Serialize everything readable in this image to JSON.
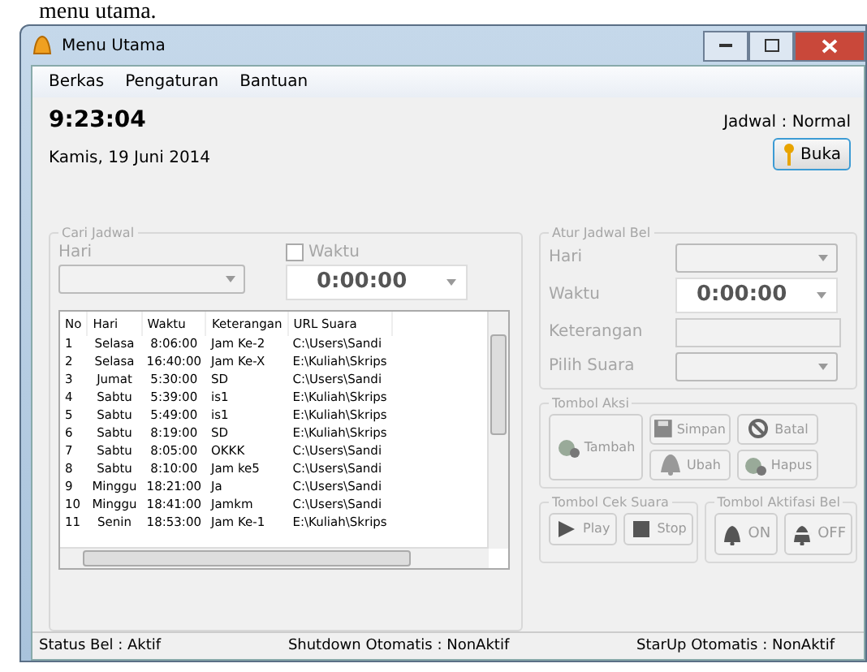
{
  "caption": "menu utama.",
  "window": {
    "title": "Menu Utama"
  },
  "menu": [
    "Berkas",
    "Pengaturan",
    "Bantuan"
  ],
  "clock": "9:23:04",
  "date": "Kamis, 19 Juni 2014",
  "schedule": "Jadwal : Normal",
  "open_button": {
    "label": "Buka",
    "disabled": false
  },
  "search": {
    "title": "Cari Jadwal",
    "disabled": true,
    "day_label": "Hari",
    "time_checkbox": {
      "label": "Waktu",
      "checked": false
    },
    "time": "0:00:00"
  },
  "table": {
    "columns": [
      "No",
      "Hari",
      "Waktu",
      "Keterangan",
      "URL Suara"
    ],
    "rows": [
      [
        "1",
        "Selasa",
        "8:06:00",
        "Jam Ke-2",
        "C:\\Users\\Sandi"
      ],
      [
        "2",
        "Selasa",
        "16:40:00",
        "Jam Ke-X",
        "E:\\Kuliah\\Skrips"
      ],
      [
        "3",
        "Jumat",
        "5:30:00",
        "SD",
        "C:\\Users\\Sandi"
      ],
      [
        "4",
        "Sabtu",
        "5:39:00",
        "is1",
        "E:\\Kuliah\\Skrips"
      ],
      [
        "5",
        "Sabtu",
        "5:49:00",
        "is1",
        "E:\\Kuliah\\Skrips"
      ],
      [
        "6",
        "Sabtu",
        "8:19:00",
        "SD",
        "E:\\Kuliah\\Skrips"
      ],
      [
        "7",
        "Sabtu",
        "8:05:00",
        "OKKK",
        "C:\\Users\\Sandi"
      ],
      [
        "8",
        "Sabtu",
        "8:10:00",
        "Jam ke5",
        "C:\\Users\\Sandi"
      ],
      [
        "9",
        "Minggu",
        "18:21:00",
        "Ja",
        "C:\\Users\\Sandi"
      ],
      [
        "10",
        "Minggu",
        "18:41:00",
        "Jamkm",
        "C:\\Users\\Sandi"
      ],
      [
        "11",
        "Senin",
        "18:53:00",
        "Jam Ke-1",
        "E:\\Kuliah\\Skrips"
      ]
    ]
  },
  "schedule_form": {
    "title": "Atur Jadwal Bel",
    "disabled": true,
    "fields": [
      {
        "label": "Hari",
        "kind": "combo"
      },
      {
        "label": "Waktu",
        "kind": "time",
        "value": "0:00:00"
      },
      {
        "label": "Keterangan",
        "kind": "text"
      },
      {
        "label": "Pilih Suara",
        "kind": "combo"
      }
    ]
  },
  "actions": {
    "title": "Tombol Aksi",
    "buttons": [
      {
        "label": "Tambah",
        "kind": "add",
        "disabled": true
      },
      {
        "label": "Simpan",
        "kind": "save",
        "disabled": true
      },
      {
        "label": "Batal",
        "kind": "cancel",
        "disabled": true
      },
      {
        "label": "Ubah",
        "kind": "edit",
        "disabled": true
      },
      {
        "label": "Hapus",
        "kind": "delete",
        "disabled": true
      }
    ]
  },
  "sound_check": {
    "title": "Tombol Cek Suara",
    "buttons": [
      {
        "label": "Play",
        "kind": "play",
        "disabled": true
      },
      {
        "label": "Stop",
        "kind": "stop",
        "disabled": true
      }
    ]
  },
  "bell_toggle": {
    "title": "Tombol Aktifasi Bel",
    "buttons": [
      {
        "label": "ON",
        "kind": "bell",
        "disabled": true
      },
      {
        "label": "OFF",
        "kind": "bell-off",
        "disabled": true
      }
    ]
  },
  "status_bar": [
    "Status Bel : Aktif",
    "Shutdown Otomatis : NonAktif",
    "StarUp Otomatis : NonAktif"
  ]
}
